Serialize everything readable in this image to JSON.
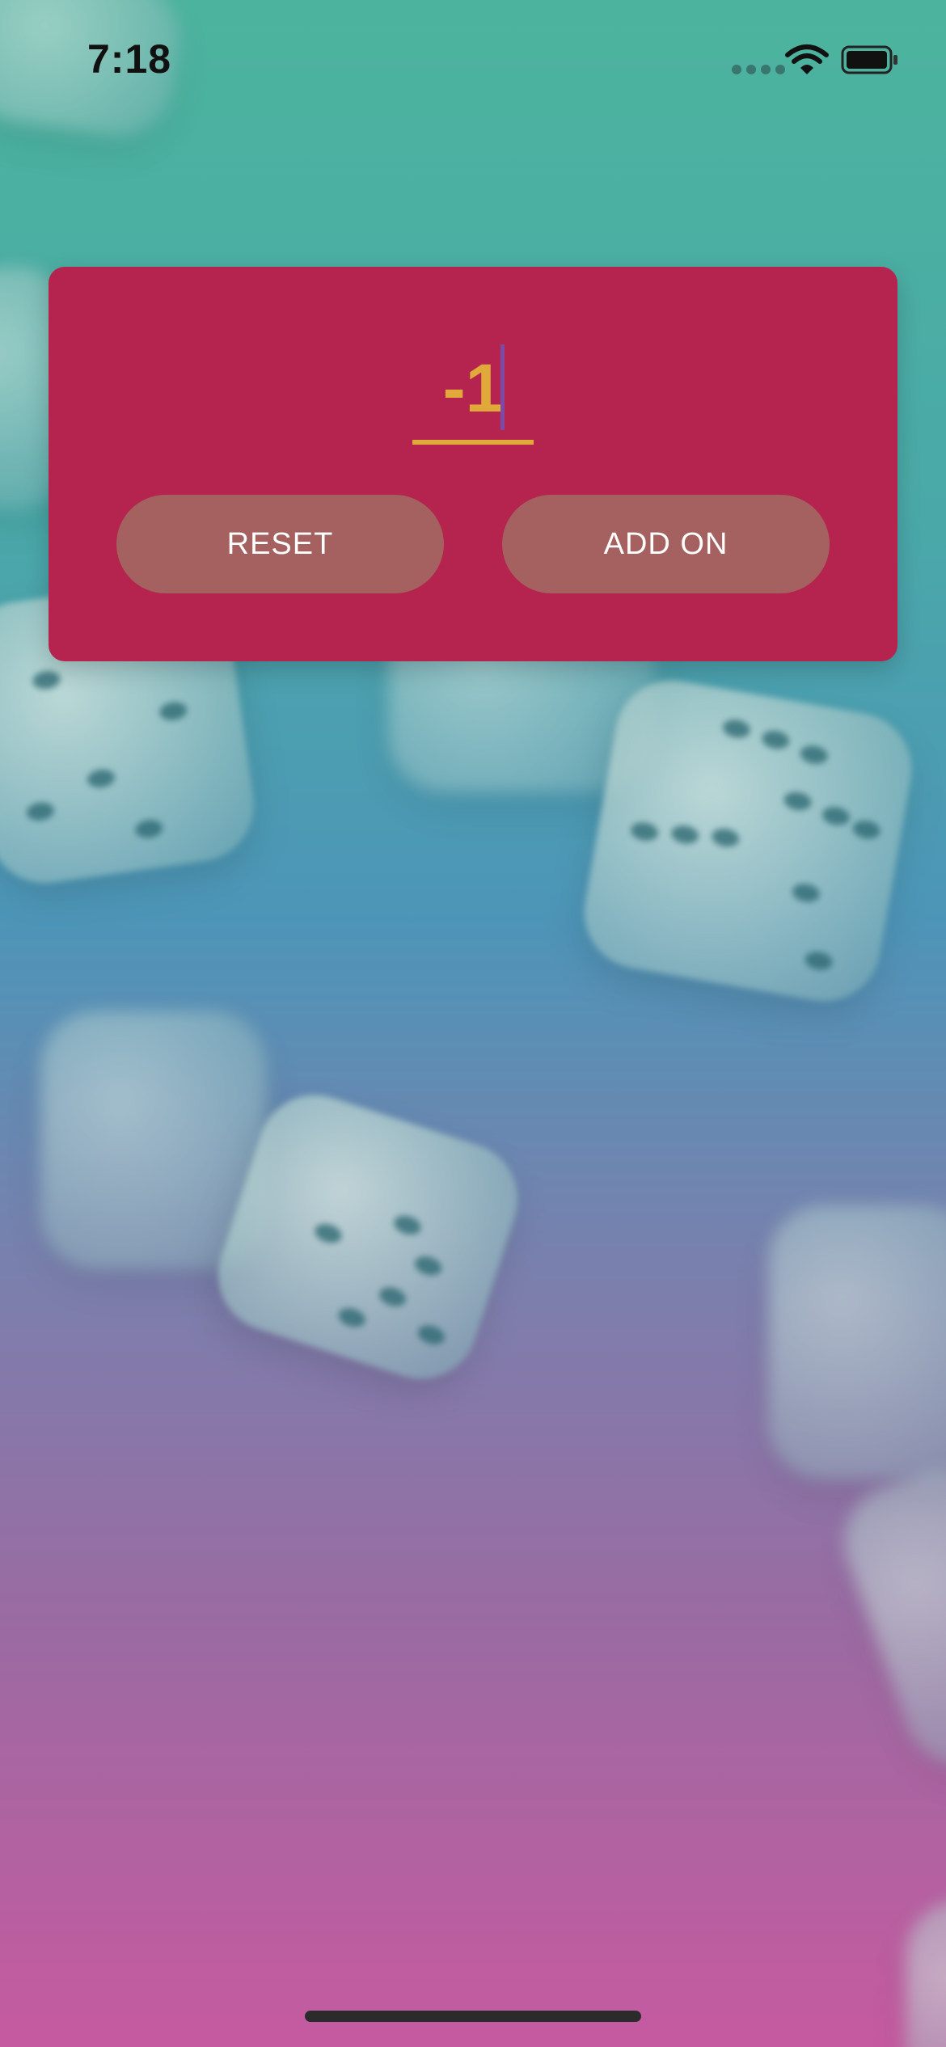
{
  "status_bar": {
    "time": "7:18",
    "wifi_icon": "wifi-icon",
    "battery_icon": "battery-icon",
    "signal_icon": "cellular-signal-dots-icon"
  },
  "counter": {
    "value": "-1",
    "value_color": "#e0a93a",
    "card_color": "#b4244e"
  },
  "actions": {
    "reset_label": "RESET",
    "add_label": "ADD ON",
    "button_color": "#a56060"
  },
  "background": {
    "decoration": "dice",
    "gradient_colors": [
      "#4cb49e",
      "#4d95b8",
      "#c65aa0"
    ]
  }
}
